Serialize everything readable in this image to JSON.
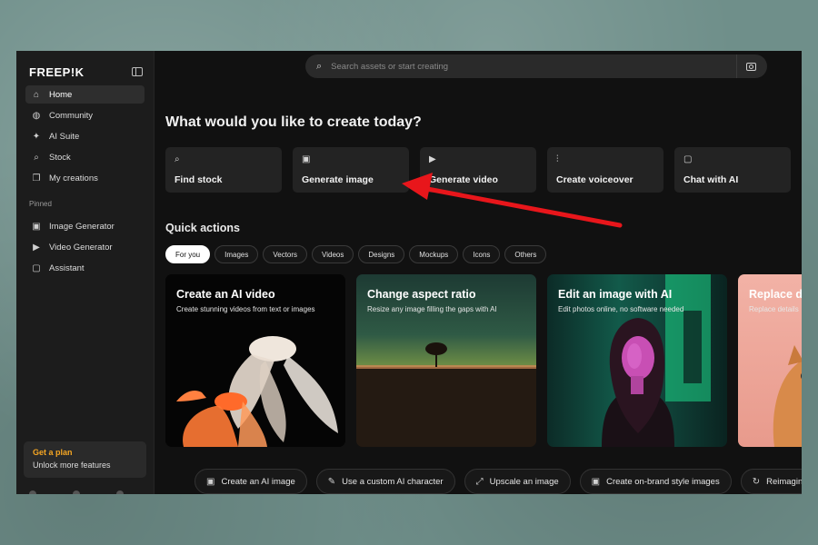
{
  "sidebar": {
    "logo": "FREEP!K",
    "items": [
      {
        "label": "Home",
        "icon": "home-icon",
        "glyph": "⌂"
      },
      {
        "label": "Community",
        "icon": "globe-icon",
        "glyph": "◍"
      },
      {
        "label": "AI Suite",
        "icon": "sparkle-icon",
        "glyph": "✦"
      },
      {
        "label": "Stock",
        "icon": "search-icon",
        "glyph": "⌕"
      },
      {
        "label": "My creations",
        "icon": "folder-icon",
        "glyph": "❐"
      }
    ],
    "pinned_label": "Pinned",
    "pinned": [
      {
        "label": "Image Generator",
        "icon": "image-icon",
        "glyph": "▣"
      },
      {
        "label": "Video Generator",
        "icon": "video-icon",
        "glyph": "▶"
      },
      {
        "label": "Assistant",
        "icon": "chat-icon",
        "glyph": "▢"
      }
    ],
    "plan": {
      "title": "Get a plan",
      "subtitle": "Unlock more features"
    }
  },
  "search": {
    "placeholder": "Search assets or start creating"
  },
  "headline": "What would you like to create today?",
  "create_cards": [
    {
      "label": "Find stock",
      "icon": "search-icon",
      "glyph": "⌕"
    },
    {
      "label": "Generate image",
      "icon": "image-icon",
      "glyph": "▣"
    },
    {
      "label": "Generate video",
      "icon": "video-icon",
      "glyph": "▶"
    },
    {
      "label": "Create voiceover",
      "icon": "waveform-icon",
      "glyph": "⫶"
    },
    {
      "label": "Chat with AI",
      "icon": "chat-icon",
      "glyph": "▢"
    }
  ],
  "quick_actions": {
    "title": "Quick actions",
    "chips": [
      "For you",
      "Images",
      "Vectors",
      "Videos",
      "Designs",
      "Mockups",
      "Icons",
      "Others"
    ],
    "active_chip": "For you"
  },
  "feature_cards": [
    {
      "title": "Create an AI video",
      "subtitle": "Create stunning videos from text or images"
    },
    {
      "title": "Change aspect ratio",
      "subtitle": "Resize any image filling the gaps with AI"
    },
    {
      "title": "Edit an image with AI",
      "subtitle": "Edit photos online, no software needed"
    },
    {
      "title": "Replace d",
      "subtitle": "Replace details"
    }
  ],
  "bottom_actions": [
    {
      "label": "Create an AI image",
      "icon": "ai-image-icon",
      "glyph": "▣"
    },
    {
      "label": "Use a custom AI character",
      "icon": "wand-icon",
      "glyph": "✎"
    },
    {
      "label": "Upscale an image",
      "icon": "upscale-icon",
      "glyph": "⤢"
    },
    {
      "label": "Create on-brand style images",
      "icon": "image-icon",
      "glyph": "▣"
    },
    {
      "label": "Reimagine",
      "icon": "refresh-icon",
      "glyph": "↻"
    }
  ],
  "colors": {
    "accent_plan": "#f5a623",
    "arrow": "#e8161b",
    "background": "#111111"
  }
}
